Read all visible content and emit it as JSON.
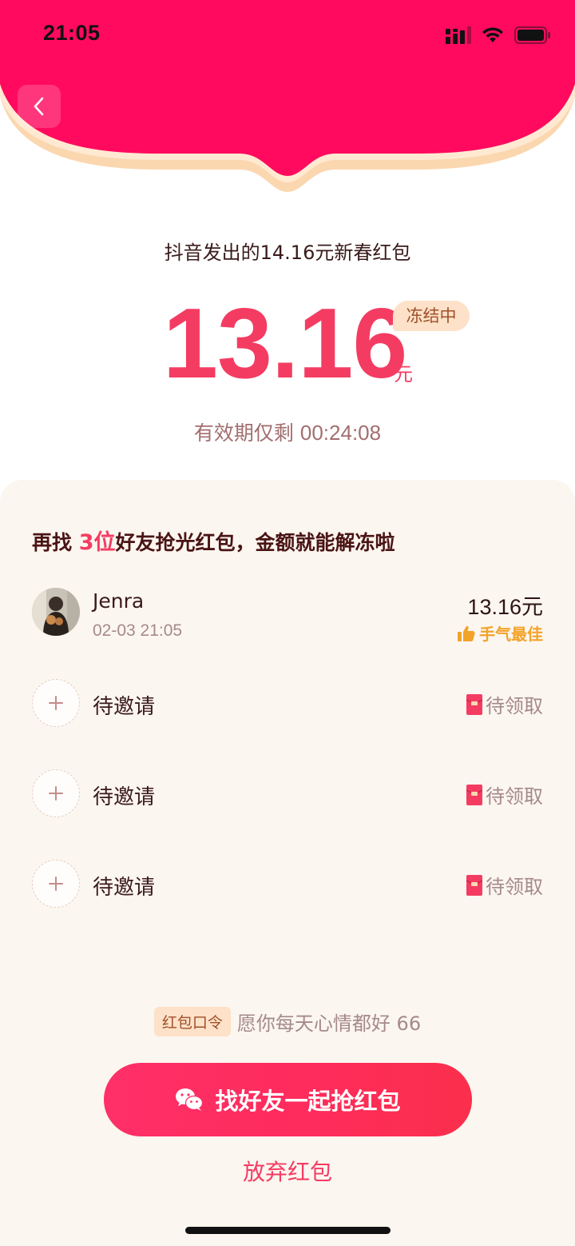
{
  "status_bar": {
    "time": "21:05"
  },
  "header": {
    "back_icon": "chevron-left-icon",
    "colors": {
      "primary": "#ff0a5e",
      "trim": "#fbd7b0"
    }
  },
  "red_packet": {
    "sender_line": "抖音发出的14.16元新春红包",
    "amount": "13.16",
    "unit": "元",
    "status_badge": "冻结中",
    "validity_label": "有效期仅剩",
    "countdown": "00:24:08",
    "accent_color": "#f43c62"
  },
  "invite": {
    "title_prefix": "再找",
    "title_count": "3位",
    "title_suffix": "好友抢光红包，金额就能解冻啦"
  },
  "recipients": [
    {
      "name": "Jenra",
      "time": "02-03 21:05",
      "amount": "13.16元",
      "badge": "手气最佳",
      "badge_icon": "thumbs-up-icon"
    }
  ],
  "pending_slots": [
    {
      "label": "待邀请",
      "status": "待领取",
      "icon": "red-envelope-icon"
    },
    {
      "label": "待邀请",
      "status": "待领取",
      "icon": "red-envelope-icon"
    },
    {
      "label": "待邀请",
      "status": "待领取",
      "icon": "red-envelope-icon"
    }
  ],
  "password": {
    "tag": "红包口令",
    "text": "愿你每天心情都好 66"
  },
  "actions": {
    "share_label": "找好友一起抢红包",
    "share_icon": "wechat-icon",
    "abandon_label": "放弃红包"
  }
}
